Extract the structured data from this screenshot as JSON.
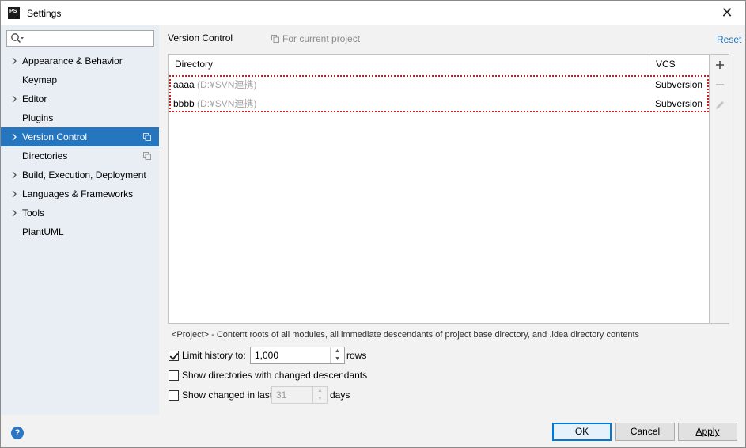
{
  "window": {
    "title": "Settings",
    "app_icon": "PS"
  },
  "sidebar": {
    "search_placeholder": "",
    "items": [
      {
        "label": "Appearance & Behavior",
        "expandable": true
      },
      {
        "label": "Keymap",
        "expandable": false
      },
      {
        "label": "Editor",
        "expandable": true
      },
      {
        "label": "Plugins",
        "expandable": false
      },
      {
        "label": "Version Control",
        "expandable": true,
        "selected": true
      },
      {
        "label": "Directories",
        "expandable": false
      },
      {
        "label": "Build, Execution, Deployment",
        "expandable": true
      },
      {
        "label": "Languages & Frameworks",
        "expandable": true
      },
      {
        "label": "Tools",
        "expandable": true
      },
      {
        "label": "PlantUML",
        "expandable": false
      }
    ]
  },
  "main": {
    "breadcrumb": "Version Control",
    "scope_label": "For current project",
    "reset_label": "Reset",
    "table": {
      "columns": [
        "Directory",
        "VCS"
      ],
      "rows": [
        {
          "name": "aaaa",
          "path": "(D:¥SVN連携)",
          "vcs": "Subversion"
        },
        {
          "name": "bbbb",
          "path": "(D:¥SVN連携)",
          "vcs": "Subversion"
        }
      ]
    },
    "note": "<Project> - Content roots of all modules, all immediate descendants of project base directory, and .idea directory contents",
    "limit_history": {
      "label": "Limit history to:",
      "checked": true,
      "value": "1,000",
      "suffix": "rows"
    },
    "show_dirs": {
      "label": "Show directories with changed descendants",
      "checked": false
    },
    "show_changed": {
      "label": "Show changed in last",
      "checked": false,
      "value": "31",
      "suffix": "days"
    }
  },
  "footer": {
    "help_label": "?",
    "ok_label": "OK",
    "cancel_label": "Cancel",
    "apply_label": "Apply"
  },
  "colors": {
    "selection": "#2675bf",
    "link": "#2470b3",
    "highlight_outline": "#cc1f1f"
  }
}
